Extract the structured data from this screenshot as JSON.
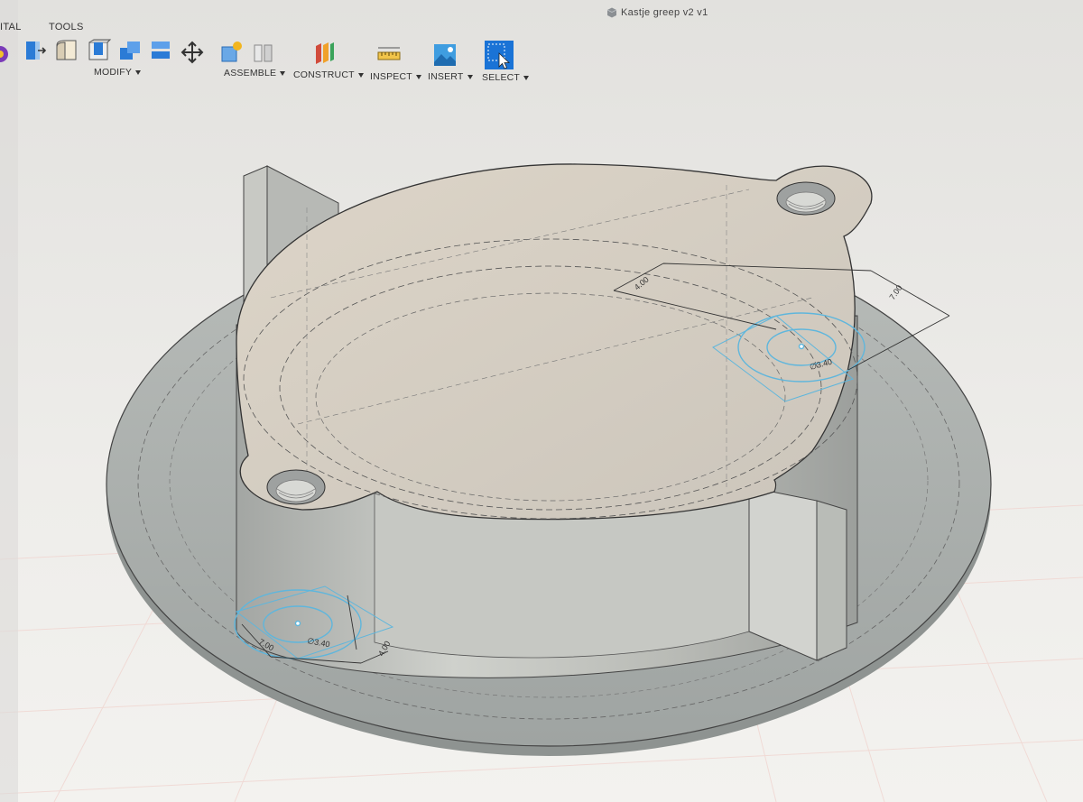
{
  "window": {
    "title": "Kastje greep v2 v1"
  },
  "tabs": [
    {
      "label": "ITAL"
    },
    {
      "label": "TOOLS"
    }
  ],
  "toolbar_groups": [
    {
      "id": "modify",
      "label": "MODIFY"
    },
    {
      "id": "assemble",
      "label": "ASSEMBLE"
    },
    {
      "id": "construct",
      "label": "CONSTRUCT"
    },
    {
      "id": "inspect",
      "label": "INSPECT"
    },
    {
      "id": "insert",
      "label": "INSERT"
    },
    {
      "id": "select",
      "label": "SELECT"
    }
  ],
  "icons": {
    "modify": [
      "press-pull-icon",
      "fillet-icon",
      "shell-icon",
      "combine-icon",
      "align-icon",
      "move-icon"
    ],
    "assemble": [
      "new-component-icon",
      "joint-icon"
    ],
    "construct": [
      "offset-plane-icon"
    ],
    "inspect": [
      "measure-icon"
    ],
    "insert": [
      "insert-image-icon"
    ],
    "select": [
      "select-icon"
    ]
  },
  "dimensions": [
    {
      "label": "4.00"
    },
    {
      "label": "7.00"
    },
    {
      "label": "∅3.40"
    },
    {
      "label": "7.00"
    },
    {
      "label": "∅3.40"
    },
    {
      "label": "4.00"
    }
  ],
  "colors": {
    "background": "#ebeae7",
    "grid": "#f4d7d3",
    "body_light": "#d9d2c6",
    "body_mid": "#bcbab2",
    "body_dark": "#9ea2a0",
    "sketch_blue": "#5fb6dc",
    "select_blue": "#1a73d6"
  }
}
